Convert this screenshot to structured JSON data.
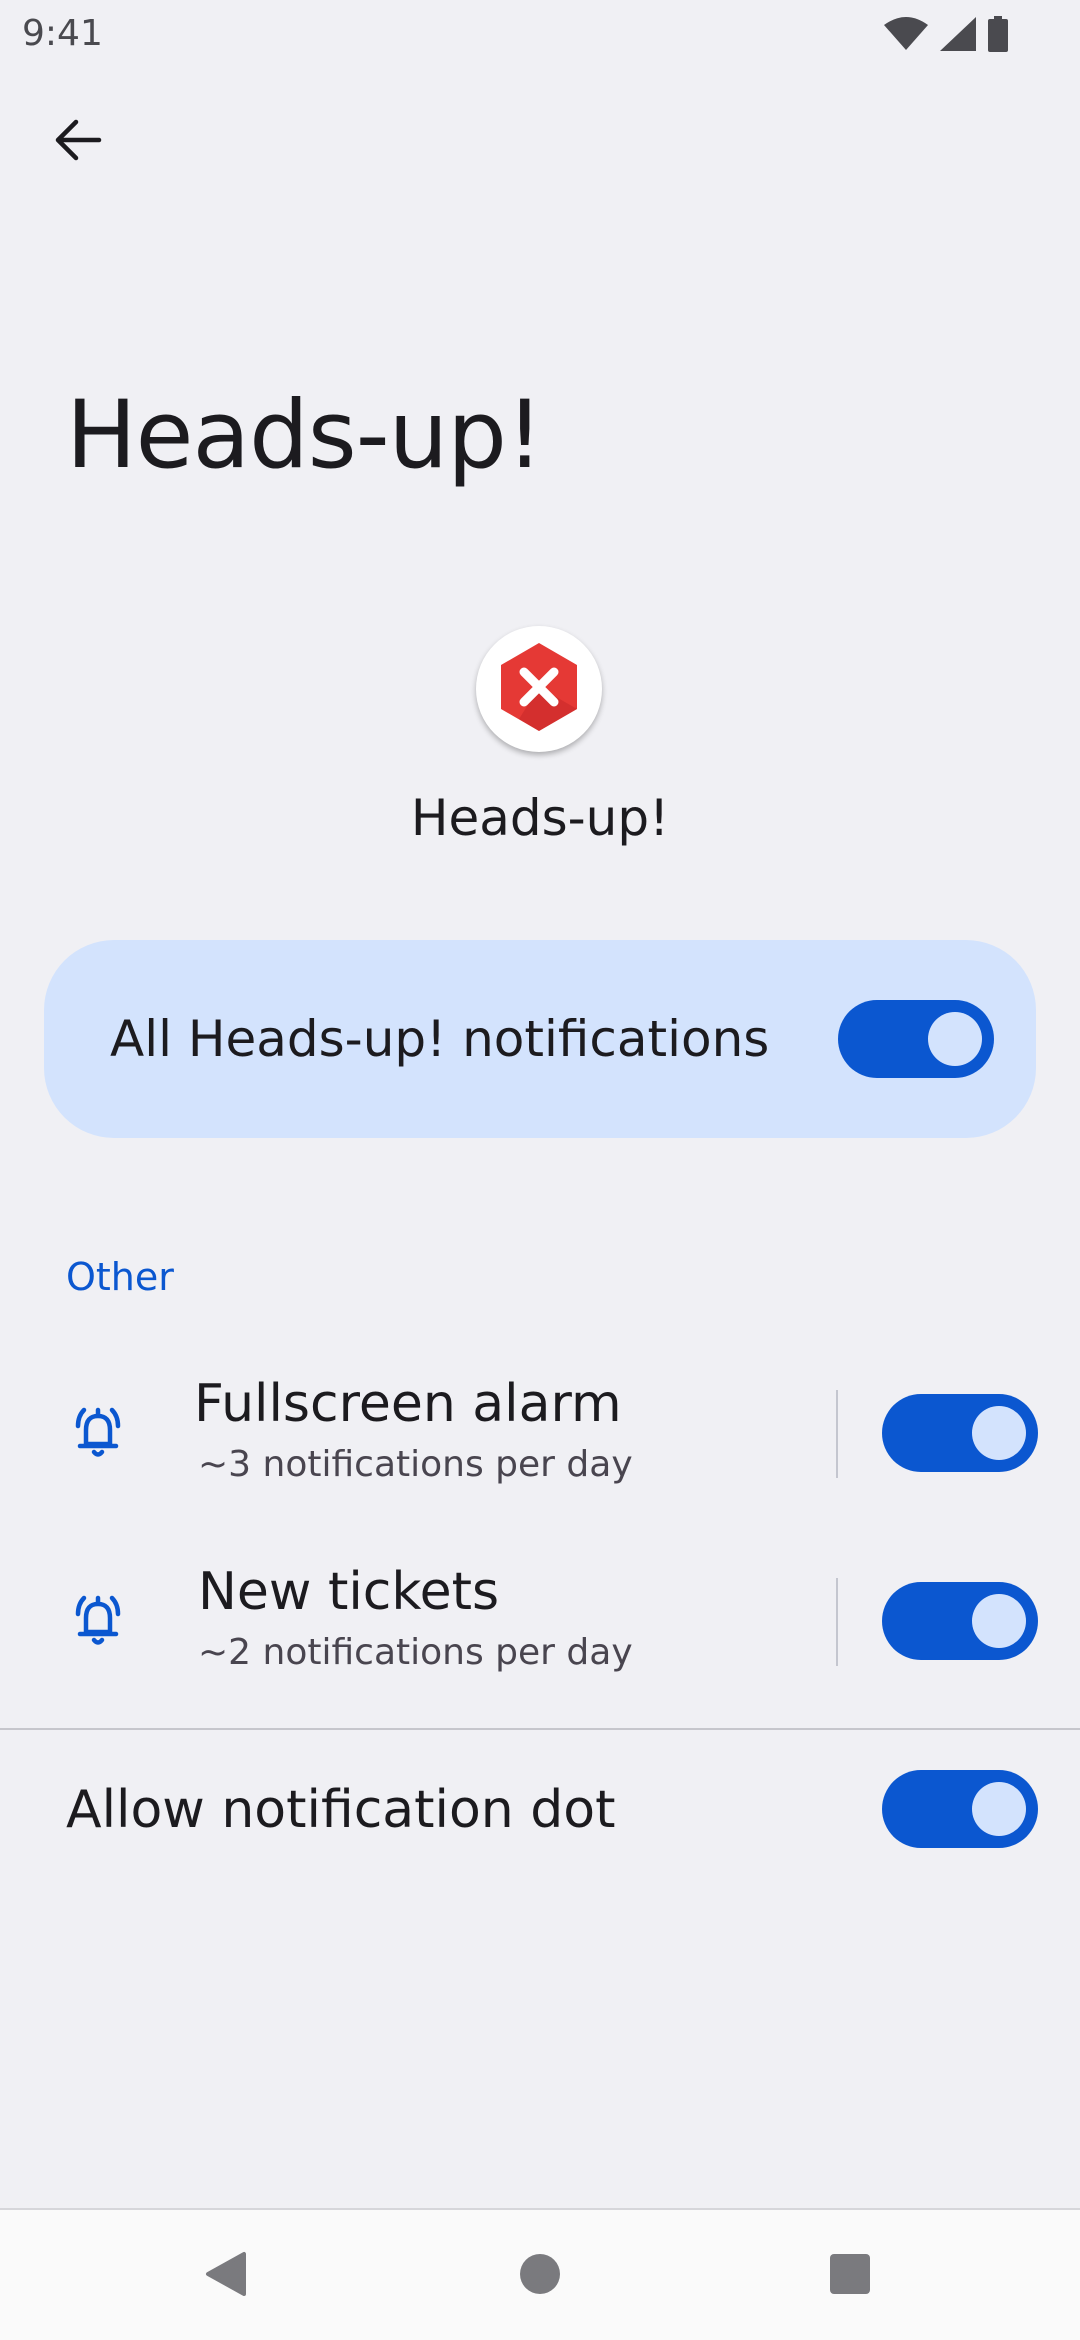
{
  "status_bar": {
    "time": "9:41",
    "icons": [
      "wifi-icon",
      "cellular-signal-icon",
      "battery-icon"
    ]
  },
  "header": {
    "back_icon": "arrow-back-icon",
    "title": "Heads-up!"
  },
  "app": {
    "icon": "app-error-hexagon-icon",
    "name": "Heads-up!",
    "icon_color": "#e53935"
  },
  "master_toggle": {
    "label": "All Heads-up! notifications",
    "enabled": true
  },
  "section": {
    "title": "Other"
  },
  "channels": [
    {
      "icon": "bell-ringing-icon",
      "title": "Fullscreen alarm",
      "subtitle": "~3 notifications per day",
      "enabled": true
    },
    {
      "icon": "bell-ringing-icon",
      "title": "New tickets",
      "subtitle": "~2 notifications per day",
      "enabled": true
    }
  ],
  "notification_dot": {
    "label": "Allow notification dot",
    "enabled": true
  },
  "nav_bar": {
    "buttons": [
      "nav-back-icon",
      "nav-home-icon",
      "nav-recents-icon"
    ]
  },
  "colors": {
    "background": "#f0f0f4",
    "accent": "#0b57d0",
    "card": "#d3e3fd",
    "text": "#1c1b1f",
    "secondary_text": "#49454f"
  }
}
